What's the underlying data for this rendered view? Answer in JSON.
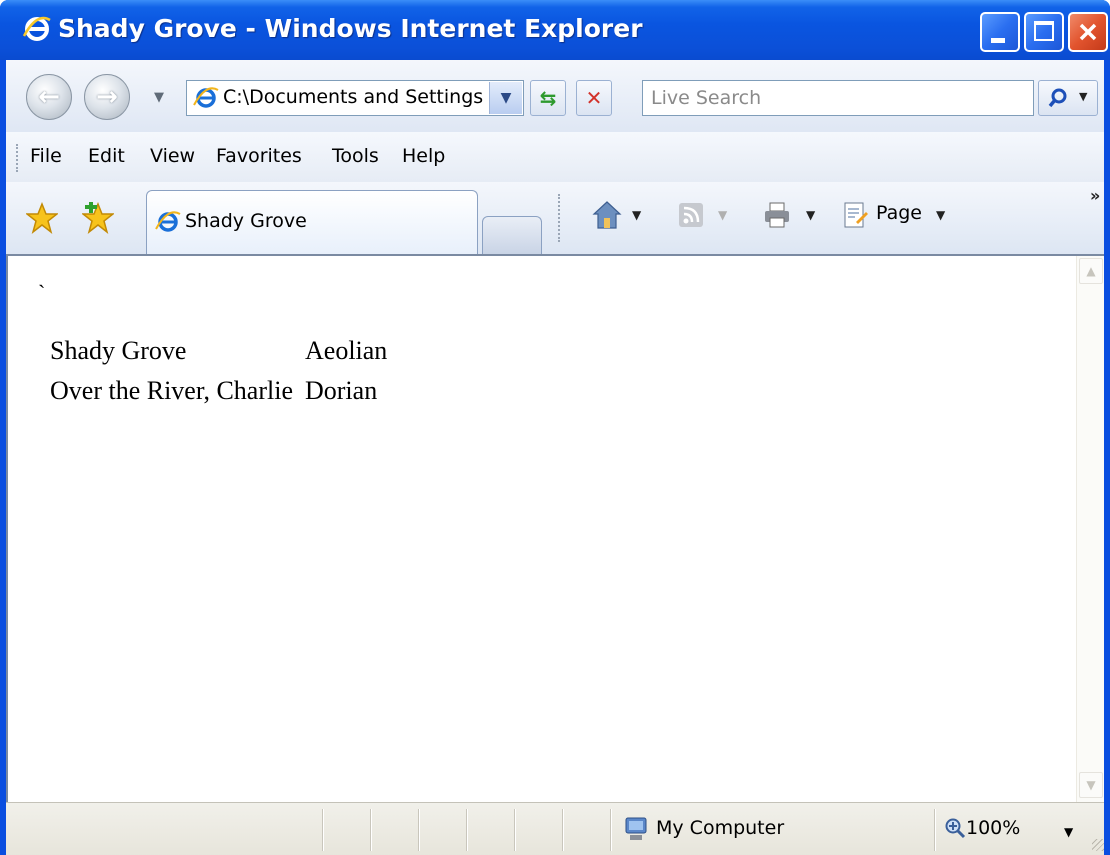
{
  "window": {
    "title": "Shady Grove - Windows Internet Explorer"
  },
  "navbar": {
    "address": "C:\\Documents and Settings",
    "search_placeholder": "Live Search"
  },
  "menu": {
    "items": [
      "File",
      "Edit",
      "View",
      "Favorites",
      "Tools",
      "Help"
    ]
  },
  "tabs": {
    "active_tab": "Shady Grove"
  },
  "toolbar": {
    "page_label": "Page",
    "overflow_label": "»"
  },
  "content": {
    "stray_mark": "`",
    "rows": [
      {
        "song": "Shady Grove",
        "mode": "Aeolian"
      },
      {
        "song": "Over the River, Charlie",
        "mode": "Dorian"
      }
    ]
  },
  "statusbar": {
    "zone": "My Computer",
    "zoom": "100%"
  },
  "colors": {
    "titlebar": "#0a55e0",
    "close_button": "#e2542e",
    "ie_blue": "#1a6fd8"
  }
}
